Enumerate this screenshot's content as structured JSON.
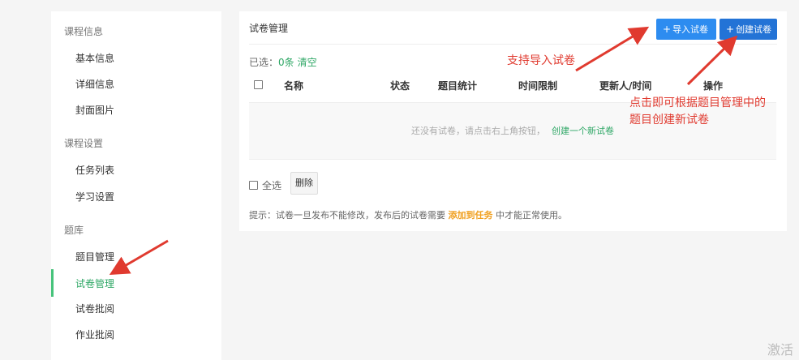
{
  "sidebar": {
    "groups": [
      {
        "title": "课程信息",
        "items": [
          "基本信息",
          "详细信息",
          "封面图片"
        ]
      },
      {
        "title": "课程设置",
        "items": [
          "任务列表",
          "学习设置"
        ]
      },
      {
        "title": "题库",
        "items": [
          "题目管理",
          "试卷管理",
          "试卷批阅",
          "作业批阅"
        ]
      }
    ],
    "active_item": "试卷管理"
  },
  "main": {
    "title": "试卷管理",
    "import_button": "导入试卷",
    "create_button": "创建试卷",
    "selected_label": "已选：",
    "selected_count": "0条",
    "clear_label": "清空",
    "columns": [
      "名称",
      "状态",
      "题目统计",
      "时间限制",
      "更新人/时间",
      "操作"
    ],
    "empty_message": "还没有试卷，请点击右上角按钮，",
    "empty_link": "创建一个新试卷",
    "select_all_label": "全选",
    "delete_button": "删除",
    "tip_prefix": "提示：试卷一旦发布不能修改，发布后的试卷需要",
    "tip_link": "添加到任务",
    "tip_suffix": "中才能正常使用。"
  },
  "annotations": {
    "import_note": "支持导入试卷",
    "create_note_line1": "点击即可根据题目管理中的",
    "create_note_line2": "题目创建新试卷"
  },
  "watermark": "激活",
  "colors": {
    "accent_green": "#2fa766",
    "button_blue": "#2d8cf0",
    "annotation_red": "#e03a2f",
    "tip_orange": "#f0a020"
  }
}
